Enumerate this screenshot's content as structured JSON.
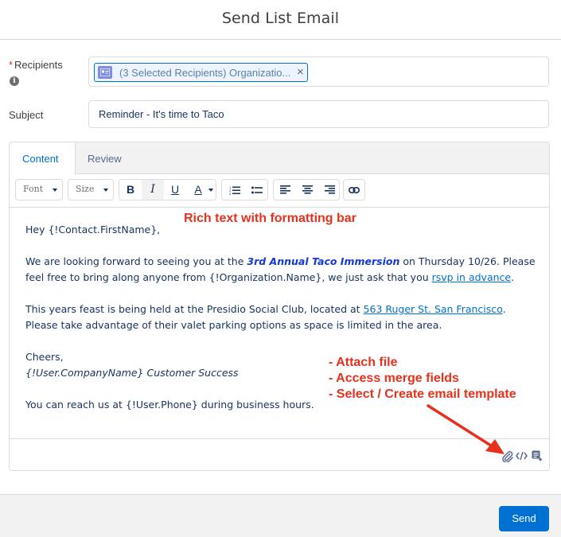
{
  "modal": {
    "title": "Send List Email"
  },
  "recipients": {
    "required_mark": "*",
    "label": "Recipients",
    "pill_label": "(3 Selected Recipients) Organizatio...",
    "pill_close": "×",
    "info_glyph": "i"
  },
  "subject": {
    "label": "Subject",
    "value": "Reminder - It's time to Taco"
  },
  "tabs": [
    {
      "label": "Content",
      "active": true
    },
    {
      "label": "Review",
      "active": false
    }
  ],
  "toolbar": {
    "font_label": "Font",
    "size_label": "Size",
    "bold": "B",
    "italic": "I",
    "underline": "U",
    "text_color": "A"
  },
  "body": {
    "greeting": "Hey {!Contact.FirstName},",
    "p1_a": "We are looking forward to seeing you at the ",
    "p1_event": "3rd Annual Taco Immersion",
    "p1_b": " on Thursday 10/26. Please feel free to bring along anyone from {!Organization.Name}, we just ask that you ",
    "p1_link": "rsvp in advance",
    "p1_c": ".",
    "p2_a": "This years feast is being held at the Presidio Social Club, located at ",
    "p2_link": "563 Ruger St. San Francisco",
    "p2_b": ". Please take advantage of their valet parking options as space is limited in the area.",
    "signoff": "Cheers,",
    "signature": "{!User.CompanyName} Customer Success",
    "contact": "You can reach us at {!User.Phone} during business hours."
  },
  "annotations": {
    "rich_text": "Rich text with formatting bar",
    "attach": "- Attach file",
    "merge": "- Access merge fields",
    "template": "- Select / Create email template"
  },
  "footer": {
    "send_label": "Send"
  },
  "colors": {
    "brand": "#0070d2",
    "annotation": "#e8311d",
    "pill_bg": "#eef4ff"
  }
}
